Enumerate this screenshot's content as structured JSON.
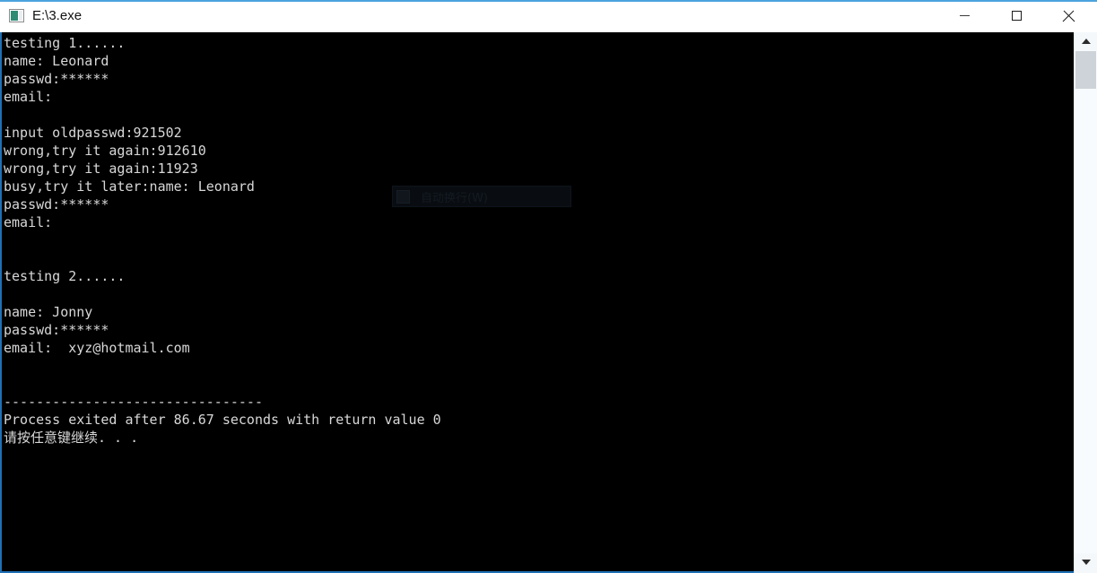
{
  "window": {
    "title": "E:\\3.exe",
    "icon": "console-window-icon",
    "accent_color": "#4ba3dd",
    "border_color": "#1f6fb5",
    "titlebar_background": "#ffffff"
  },
  "window_controls": {
    "minimize_label": "—",
    "maximize_label": "□",
    "close_label": "✕"
  },
  "console": {
    "background": "#000000",
    "foreground": "#d8d8d8",
    "output": "testing 1......\nname: Leonard\npasswd:******\nemail:\n\ninput oldpasswd:921502\nwrong,try it again:912610\nwrong,try it again:11923\nbusy,try it later:name: Leonard\npasswd:******\nemail:\n\n\ntesting 2......\n\nname: Jonny\npasswd:******\nemail:  xyz@hotmail.com\n\n\n--------------------------------\nProcess exited after 86.67 seconds with return value 0\n请按任意键继续. . ."
  },
  "ghost_overlay": {
    "label": "自动换行(W)",
    "checkbox": "checkbox-unchecked"
  },
  "scrollbar": {
    "up_arrow": "scroll-up-arrow",
    "down_arrow": "scroll-down-arrow",
    "thumb": "scroll-thumb"
  }
}
